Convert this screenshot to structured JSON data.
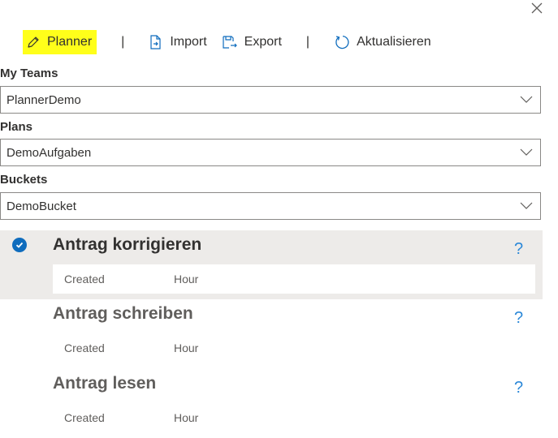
{
  "toolbar": {
    "planner_label": "Planner",
    "separator": "|",
    "import_label": "Import",
    "export_label": "Export",
    "refresh_label": "Aktualisieren",
    "highlight_color": "#ffff1a"
  },
  "fields": {
    "teams": {
      "label": "My Teams",
      "value": "PlannerDemo"
    },
    "plans": {
      "label": "Plans",
      "value": "DemoAufgaben"
    },
    "buckets": {
      "label": "Buckets",
      "value": "DemoBucket"
    }
  },
  "tasks": [
    {
      "title": "Antrag korrigieren",
      "created_label": "Created",
      "hour_label": "Hour",
      "help": "?",
      "selected": true
    },
    {
      "title": "Antrag schreiben",
      "created_label": "Created",
      "hour_label": "Hour",
      "help": "?",
      "selected": false
    },
    {
      "title": "Antrag lesen",
      "created_label": "Created",
      "hour_label": "Hour",
      "help": "?",
      "selected": false
    }
  ],
  "colors": {
    "accent": "#0f6cbd",
    "help": "#2b88d8",
    "selected_bg": "#edebe9"
  },
  "icons": [
    "close-icon",
    "pencil-icon",
    "import-icon",
    "export-icon",
    "refresh-icon",
    "chevron-down-icon",
    "checkmark-icon",
    "help-icon"
  ]
}
